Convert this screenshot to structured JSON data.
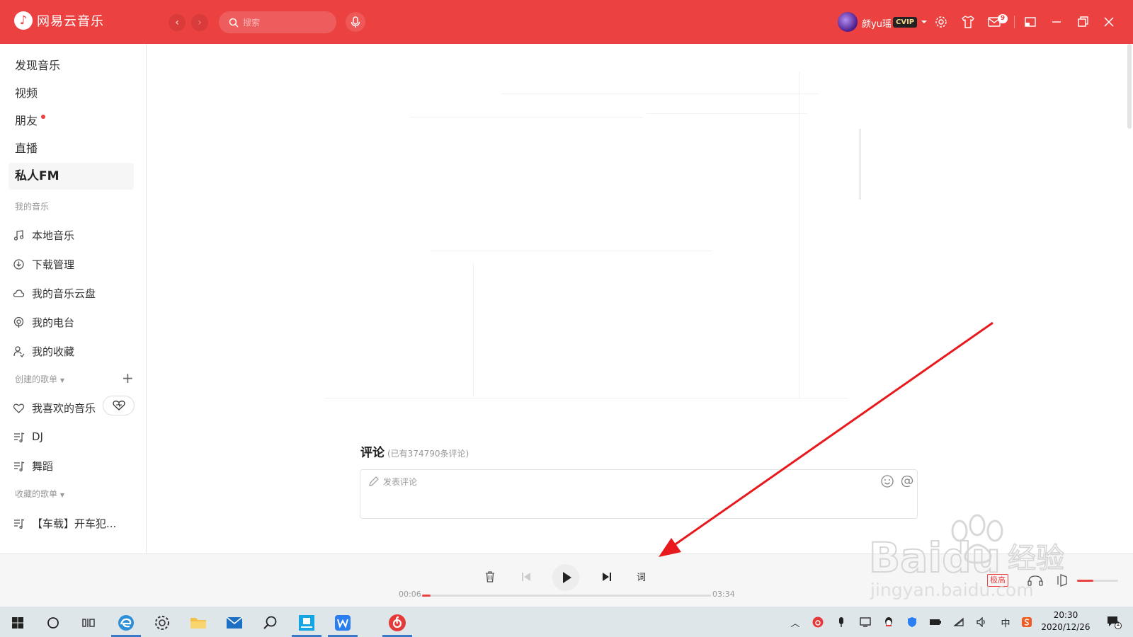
{
  "app": {
    "name": "网易云音乐",
    "accent": "#ec4141"
  },
  "header": {
    "search_placeholder": "搜索",
    "username": "颜yu瑶",
    "vip_label": "CVIP",
    "mail_badge": "9"
  },
  "sidebar": {
    "nav": [
      {
        "label": "发现音乐"
      },
      {
        "label": "视频"
      },
      {
        "label": "朋友"
      },
      {
        "label": "直播"
      },
      {
        "label": "私人FM"
      }
    ],
    "my_music_title": "我的音乐",
    "my_music": [
      {
        "label": "本地音乐",
        "icon": "music-note-icon"
      },
      {
        "label": "下载管理",
        "icon": "download-icon"
      },
      {
        "label": "我的音乐云盘",
        "icon": "cloud-icon"
      },
      {
        "label": "我的电台",
        "icon": "radio-icon"
      },
      {
        "label": "我的收藏",
        "icon": "collection-icon"
      }
    ],
    "created_title": "创建的歌单",
    "created": [
      {
        "label": "我喜欢的音乐",
        "icon": "heart-icon"
      },
      {
        "label": "DJ",
        "icon": "playlist-icon"
      },
      {
        "label": "舞蹈",
        "icon": "playlist-icon"
      }
    ],
    "collected_title": "收藏的歌单",
    "collected": [
      {
        "label": "【车载】开车犯...",
        "icon": "playlist-icon"
      }
    ]
  },
  "main": {
    "comments_title": "评论",
    "comments_count": "(已有374790条评论)",
    "comment_placeholder": "发表评论"
  },
  "player": {
    "current_time": "00:06",
    "total_time": "03:34",
    "progress": 0.03,
    "lyrics_label": "词",
    "quality_label": "极高",
    "volume": 0.4
  },
  "taskbar": {
    "time": "20:30",
    "date": "2020/12/26",
    "ime": "中",
    "notification_count": "1"
  },
  "watermark": {
    "brand": "Baidu",
    "cn": "经验",
    "url": "jingyan.baidu.com"
  }
}
